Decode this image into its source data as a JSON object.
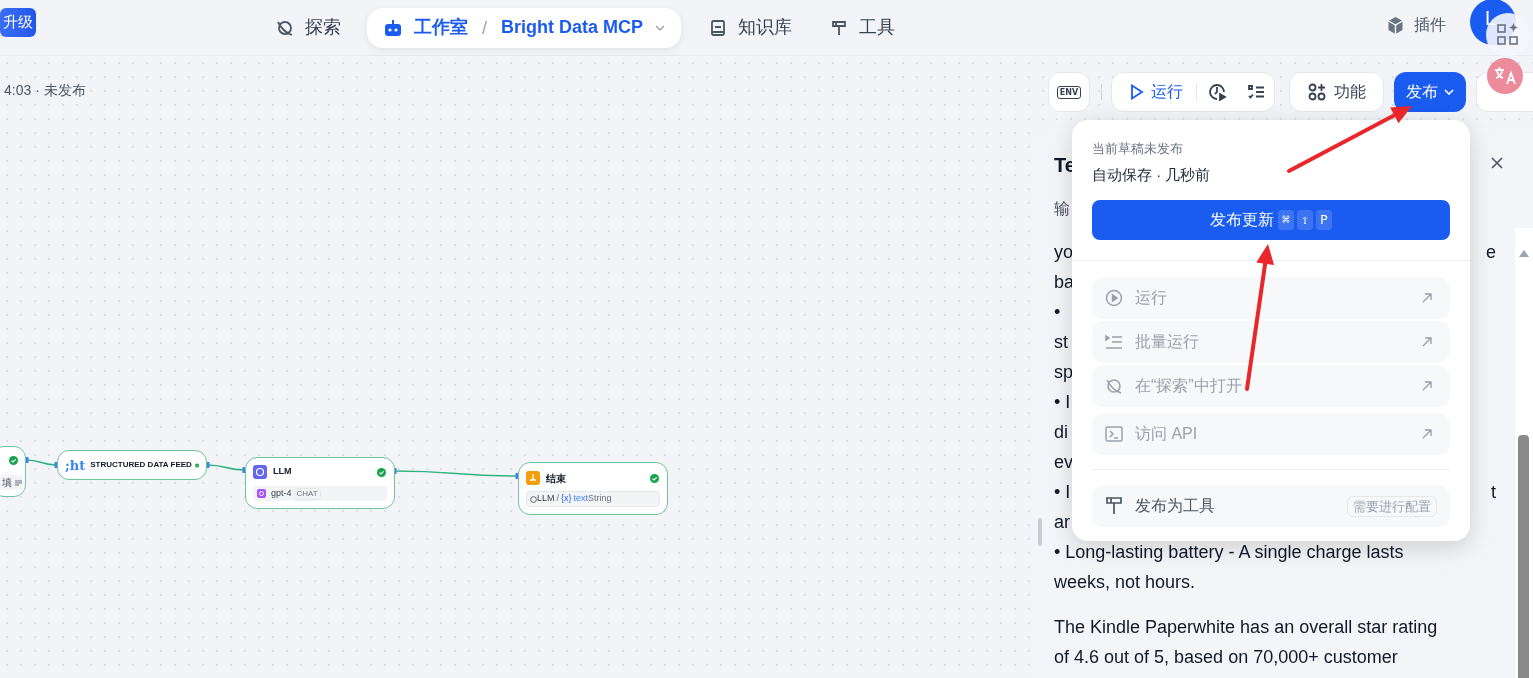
{
  "upgrade_button": "升级",
  "nav": [
    {
      "label": "探索",
      "selected": false
    },
    {
      "label": "工作室",
      "separator": "/",
      "project": "Bright Data MCP",
      "selected": true
    },
    {
      "label": "知识库",
      "selected": false
    },
    {
      "label": "工具",
      "selected": false
    }
  ],
  "plugins": "插件",
  "avatar": "L",
  "status": "4:03 · 未发布",
  "toolbar": {
    "env": "ENV",
    "run": "运行",
    "features": "功能",
    "publish": "发布"
  },
  "nodes": [
    {
      "kind": "partial",
      "label": "填",
      "ok": true
    },
    {
      "kind": "plugin",
      "logo": ";ht",
      "title": "STRUCTURED DATA FEED",
      "ok": true
    },
    {
      "kind": "llm",
      "title": "LLM",
      "model": "gpt-4",
      "mode": "CHAT",
      "ok": true
    },
    {
      "kind": "end",
      "title": "结束",
      "source": "LLM",
      "separator": "/",
      "var_icon": "{x}",
      "var": "text",
      "type": "String",
      "ok": true
    }
  ],
  "panel": {
    "title": "Te",
    "tab": "输",
    "lines": [
      {
        "left": "yo",
        "right": "e"
      },
      {
        "left": "ba"
      },
      {
        "left": "•"
      },
      {
        "left": "st"
      },
      {
        "left": "sp"
      },
      {
        "left": "• I"
      },
      {
        "left": "di"
      },
      {
        "left": "ev"
      },
      {
        "left": "• I",
        "right": "t"
      },
      {
        "left": "ar"
      },
      {
        "left": "• Long-lasting battery - A single charge lasts"
      },
      {
        "left": "weeks, not hours."
      },
      {
        "left": "The Kindle Paperwhite has an overall star rating",
        "gap": true
      },
      {
        "left": "of 4.6 out of 5, based on 70,000+ customer"
      }
    ]
  },
  "publish_menu": {
    "state": "当前草稿未发布",
    "autosave": "自动保存 · 几秒前",
    "primary": "发布更新",
    "keys": [
      "⌘",
      "⇧",
      "P"
    ],
    "items": [
      {
        "kind": "action",
        "label": "运行",
        "disabled": true
      },
      {
        "kind": "action",
        "label": "批量运行",
        "disabled": true
      },
      {
        "kind": "action",
        "label": "在“探索”中打开",
        "disabled": true
      },
      {
        "kind": "action",
        "label": "访问 API",
        "disabled": true
      },
      {
        "kind": "tool",
        "label": "发布为工具",
        "disabled": false,
        "tag": "需要进行配置"
      }
    ]
  }
}
